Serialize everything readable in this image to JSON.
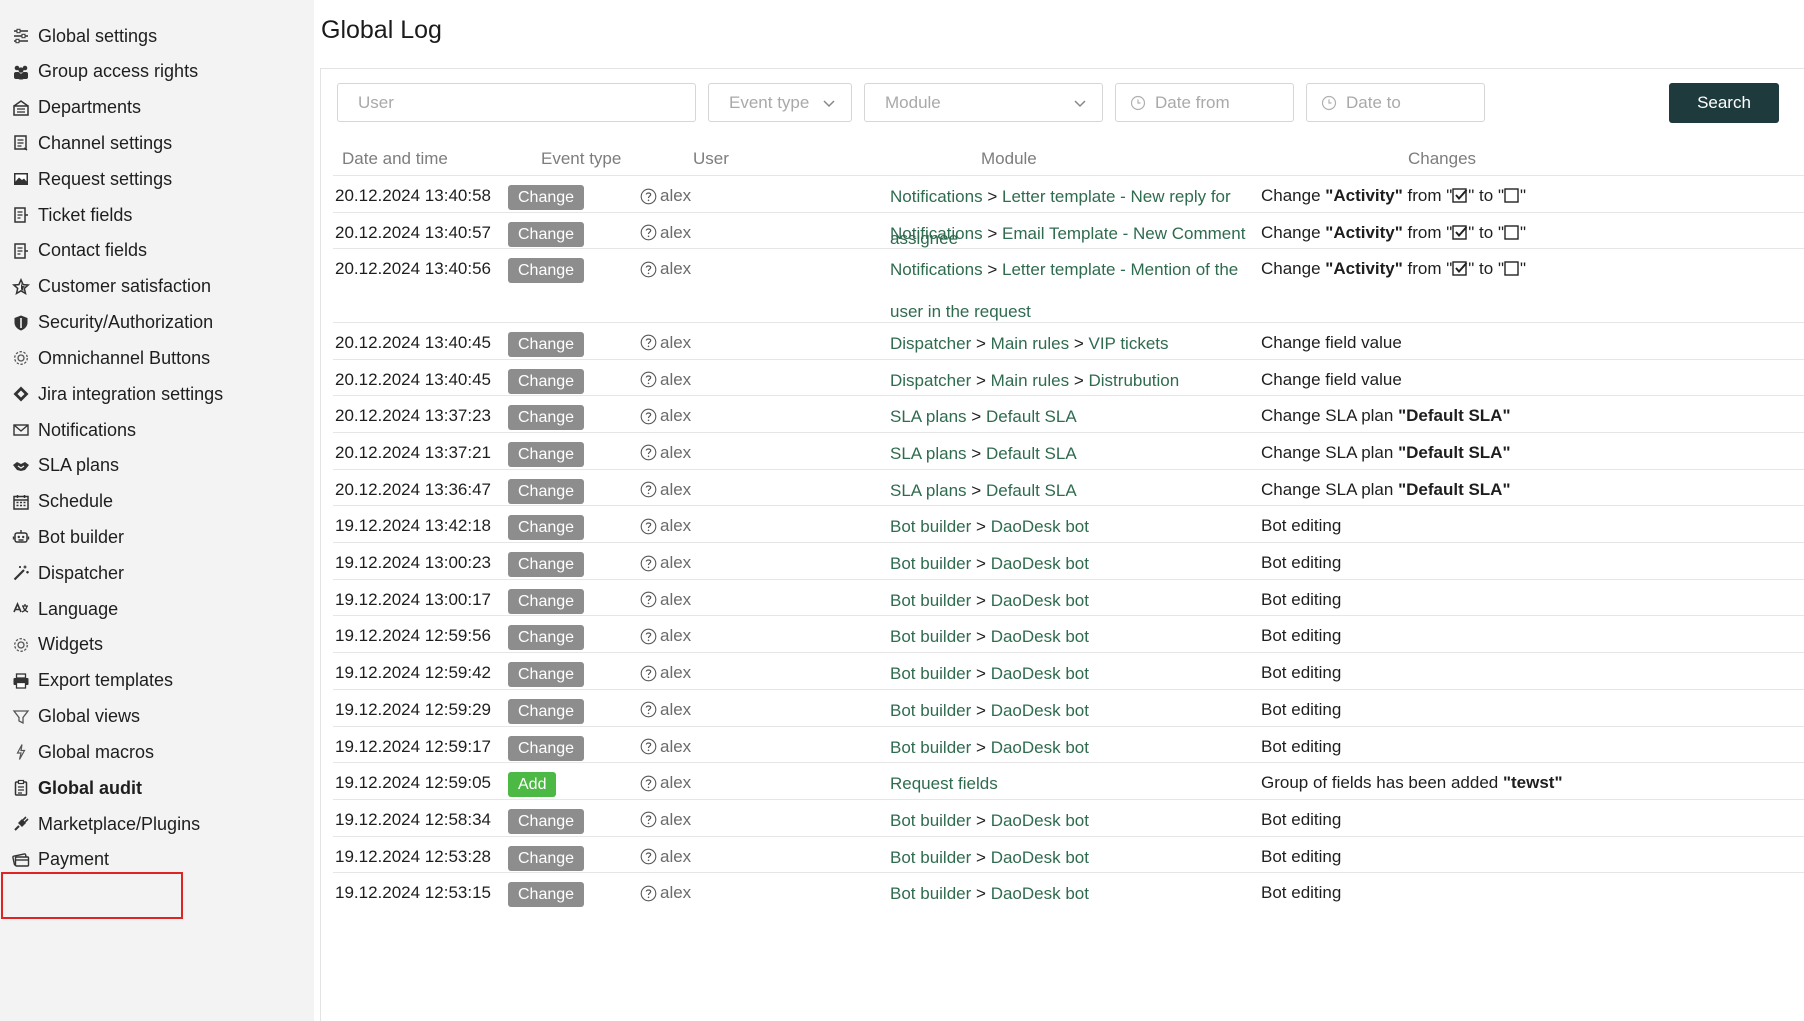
{
  "sidebar": {
    "items": [
      {
        "label": "Global settings",
        "icon": "sliders-icon"
      },
      {
        "label": "Group access rights",
        "icon": "users-group-icon"
      },
      {
        "label": "Departments",
        "icon": "building-icon"
      },
      {
        "label": "Channel settings",
        "icon": "channel-icon"
      },
      {
        "label": "Request settings",
        "icon": "image-icon"
      },
      {
        "label": "Ticket fields",
        "icon": "ticket-fields-icon"
      },
      {
        "label": "Contact fields",
        "icon": "contact-fields-icon"
      },
      {
        "label": "Customer satisfaction",
        "icon": "star-icon"
      },
      {
        "label": "Security/Authorization",
        "icon": "shield-icon"
      },
      {
        "label": "Omnichannel Buttons",
        "icon": "gear-icon"
      },
      {
        "label": "Jira integration settings",
        "icon": "jira-icon"
      },
      {
        "label": "Notifications",
        "icon": "envelope-icon"
      },
      {
        "label": "SLA plans",
        "icon": "handshake-icon"
      },
      {
        "label": "Schedule",
        "icon": "calendar-icon"
      },
      {
        "label": "Bot builder",
        "icon": "robot-icon"
      },
      {
        "label": "Dispatcher",
        "icon": "magic-wand-icon"
      },
      {
        "label": "Language",
        "icon": "language-icon"
      },
      {
        "label": "Widgets",
        "icon": "gear-icon"
      },
      {
        "label": "Export templates",
        "icon": "printer-icon"
      },
      {
        "label": "Global views",
        "icon": "filter-icon"
      },
      {
        "label": "Global macros",
        "icon": "lightning-icon"
      },
      {
        "label": "Global audit",
        "icon": "audit-clipboard-icon",
        "active": true
      },
      {
        "label": "Marketplace/Plugins",
        "icon": "plug-icon"
      },
      {
        "label": "Payment",
        "icon": "payment-icon"
      }
    ]
  },
  "page": {
    "title": "Global Log"
  },
  "filters": {
    "user_placeholder": "User",
    "event_type_placeholder": "Event type",
    "module_placeholder": "Module",
    "date_from_placeholder": "Date from",
    "date_to_placeholder": "Date to",
    "search_label": "Search"
  },
  "table": {
    "headers": {
      "datetime": "Date and time",
      "event_type": "Event type",
      "user": "User",
      "module": "Module",
      "changes": "Changes"
    },
    "module_separator": ">",
    "rows": [
      {
        "datetime": "20.12.2024 13:40:58",
        "event": "Change",
        "event_kind": "change",
        "user": "alex",
        "module": [
          "Notifications",
          "Letter template - New reply for assignee"
        ],
        "changes_html": "Change <b>\"Activity\"</b> from \"CHECKED\" to \"EMPTY\""
      },
      {
        "datetime": "20.12.2024 13:40:57",
        "event": "Change",
        "event_kind": "change",
        "user": "alex",
        "module": [
          "Notifications",
          "Email Template - New Comment"
        ],
        "changes_html": "Change <b>\"Activity\"</b> from \"CHECKED\" to \"EMPTY\""
      },
      {
        "datetime": "20.12.2024 13:40:56",
        "event": "Change",
        "event_kind": "change",
        "user": "alex",
        "module": [
          "Notifications",
          "Letter template - Mention of the user in the request"
        ],
        "changes_html": "Change <b>\"Activity\"</b> from \"CHECKED\" to \"EMPTY\"",
        "tall": true
      },
      {
        "datetime": "20.12.2024 13:40:45",
        "event": "Change",
        "event_kind": "change",
        "user": "alex",
        "module": [
          "Dispatcher",
          "Main rules",
          "VIP tickets"
        ],
        "changes_html": "Change field value"
      },
      {
        "datetime": "20.12.2024 13:40:45",
        "event": "Change",
        "event_kind": "change",
        "user": "alex",
        "module": [
          "Dispatcher",
          "Main rules",
          "Distrubution"
        ],
        "changes_html": "Change field value"
      },
      {
        "datetime": "20.12.2024 13:37:23",
        "event": "Change",
        "event_kind": "change",
        "user": "alex",
        "module": [
          "SLA plans",
          "Default SLA"
        ],
        "changes_html": "Change SLA plan <b>\"Default SLA\"</b>"
      },
      {
        "datetime": "20.12.2024 13:37:21",
        "event": "Change",
        "event_kind": "change",
        "user": "alex",
        "module": [
          "SLA plans",
          "Default SLA"
        ],
        "changes_html": "Change SLA plan <b>\"Default SLA\"</b>"
      },
      {
        "datetime": "20.12.2024 13:36:47",
        "event": "Change",
        "event_kind": "change",
        "user": "alex",
        "module": [
          "SLA plans",
          "Default SLA"
        ],
        "changes_html": "Change SLA plan <b>\"Default SLA\"</b>"
      },
      {
        "datetime": "19.12.2024 13:42:18",
        "event": "Change",
        "event_kind": "change",
        "user": "alex",
        "module": [
          "Bot builder",
          "DaoDesk bot"
        ],
        "changes_html": "Bot editing"
      },
      {
        "datetime": "19.12.2024 13:00:23",
        "event": "Change",
        "event_kind": "change",
        "user": "alex",
        "module": [
          "Bot builder",
          "DaoDesk bot"
        ],
        "changes_html": "Bot editing"
      },
      {
        "datetime": "19.12.2024 13:00:17",
        "event": "Change",
        "event_kind": "change",
        "user": "alex",
        "module": [
          "Bot builder",
          "DaoDesk bot"
        ],
        "changes_html": "Bot editing"
      },
      {
        "datetime": "19.12.2024 12:59:56",
        "event": "Change",
        "event_kind": "change",
        "user": "alex",
        "module": [
          "Bot builder",
          "DaoDesk bot"
        ],
        "changes_html": "Bot editing"
      },
      {
        "datetime": "19.12.2024 12:59:42",
        "event": "Change",
        "event_kind": "change",
        "user": "alex",
        "module": [
          "Bot builder",
          "DaoDesk bot"
        ],
        "changes_html": "Bot editing"
      },
      {
        "datetime": "19.12.2024 12:59:29",
        "event": "Change",
        "event_kind": "change",
        "user": "alex",
        "module": [
          "Bot builder",
          "DaoDesk bot"
        ],
        "changes_html": "Bot editing"
      },
      {
        "datetime": "19.12.2024 12:59:17",
        "event": "Change",
        "event_kind": "change",
        "user": "alex",
        "module": [
          "Bot builder",
          "DaoDesk bot"
        ],
        "changes_html": "Bot editing"
      },
      {
        "datetime": "19.12.2024 12:59:05",
        "event": "Add",
        "event_kind": "add",
        "user": "alex",
        "module": [
          "Request fields"
        ],
        "changes_html": "Group of fields has been added <b>\"tewst\"</b>"
      },
      {
        "datetime": "19.12.2024 12:58:34",
        "event": "Change",
        "event_kind": "change",
        "user": "alex",
        "module": [
          "Bot builder",
          "DaoDesk bot"
        ],
        "changes_html": "Bot editing"
      },
      {
        "datetime": "19.12.2024 12:53:28",
        "event": "Change",
        "event_kind": "change",
        "user": "alex",
        "module": [
          "Bot builder",
          "DaoDesk bot"
        ],
        "changes_html": "Bot editing"
      },
      {
        "datetime": "19.12.2024 12:53:15",
        "event": "Change",
        "event_kind": "change",
        "user": "alex",
        "module": [
          "Bot builder",
          "DaoDesk bot"
        ],
        "changes_html": "Bot editing"
      }
    ]
  },
  "colors": {
    "link_green": "#2f6b4f",
    "badge_change": "#8d8d8d",
    "badge_add": "#4cb944",
    "search_button": "#1f3a3d",
    "active_outline": "#e02424"
  }
}
